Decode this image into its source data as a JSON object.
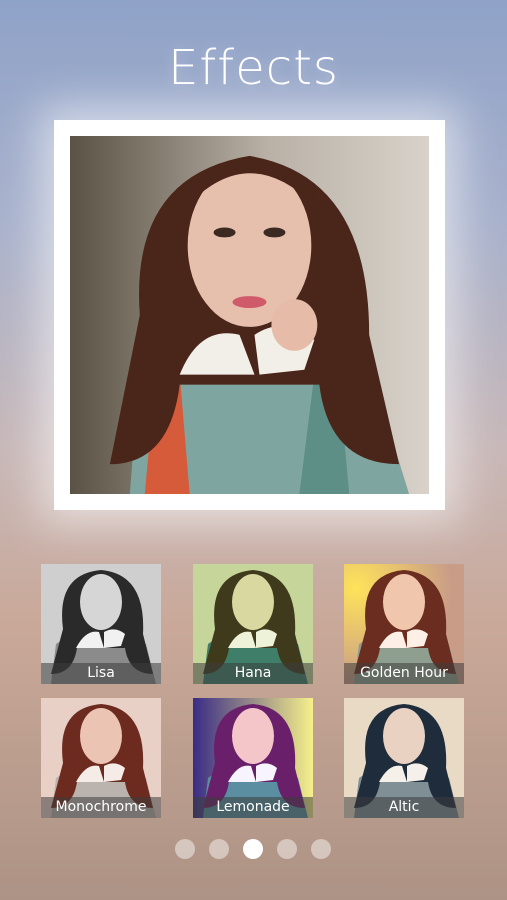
{
  "header": {
    "title": "Effects"
  },
  "effects": [
    {
      "label": "Lisa"
    },
    {
      "label": "Hana"
    },
    {
      "label": "Golden Hour"
    },
    {
      "label": "Monochrome"
    },
    {
      "label": "Lemonade"
    },
    {
      "label": "Altic"
    }
  ],
  "pager": {
    "count": 5,
    "active_index": 2
  }
}
